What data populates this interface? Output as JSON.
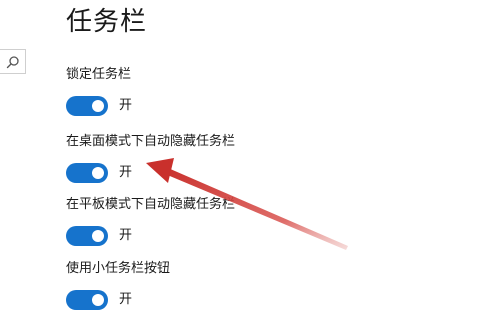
{
  "page": {
    "title": "任务栏"
  },
  "search": {
    "icon": "search-icon"
  },
  "settings": [
    {
      "label": "锁定任务栏",
      "state_label": "开",
      "on": true
    },
    {
      "label": "在桌面模式下自动隐藏任务栏",
      "state_label": "开",
      "on": true
    },
    {
      "label": "在平板模式下自动隐藏任务栏",
      "state_label": "开",
      "on": true
    },
    {
      "label": "使用小任务栏按钮",
      "state_label": "开",
      "on": true
    }
  ],
  "colors": {
    "toggle_on": "#1673cc",
    "annotation_arrow": "#d9534f"
  }
}
